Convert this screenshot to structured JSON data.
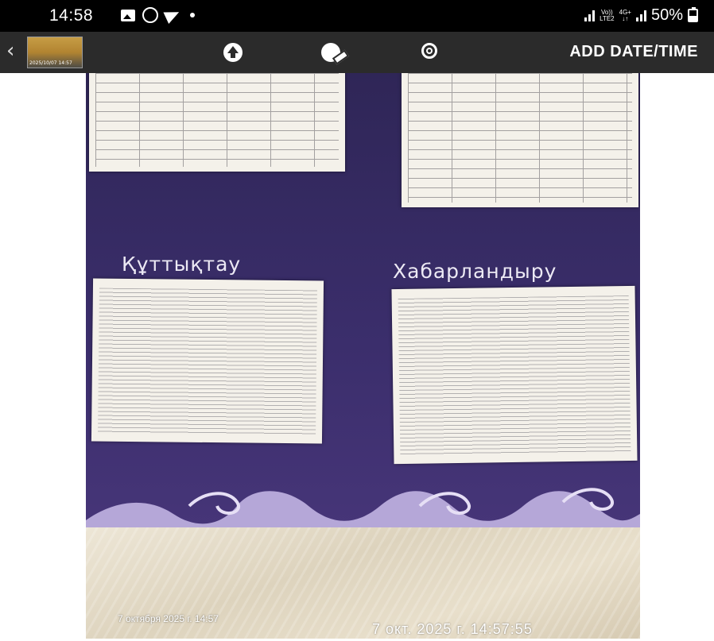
{
  "status_bar": {
    "time": "14:58",
    "network_top": "Vo))",
    "network_bottom": "LTE2",
    "data_top": "4G+",
    "data_bottom": "↓↑",
    "battery": "50%"
  },
  "toolbar": {
    "thumbnail_label": "2025/10/07 14:57",
    "add_datetime_label": "ADD DATE/TIME"
  },
  "photo": {
    "heading_left": "Құттықтау",
    "heading_right": "Хабарландыру",
    "stamp_small": "7 октября 2025 г. 14:57",
    "stamp_large": "7 окт. 2025 г. 14:57:55"
  },
  "colors": {
    "status_bar_bg": "#000000",
    "toolbar_bg": "#2b2b2b",
    "wall": "#3b2e6c",
    "ornament": "#b5a7d8"
  },
  "icons": [
    "gallery-icon",
    "whatsapp-icon",
    "telegram-icon",
    "signal-icon",
    "battery-icon",
    "back-chevron-icon",
    "upload-icon",
    "clock-edit-icon",
    "gear-icon"
  ]
}
